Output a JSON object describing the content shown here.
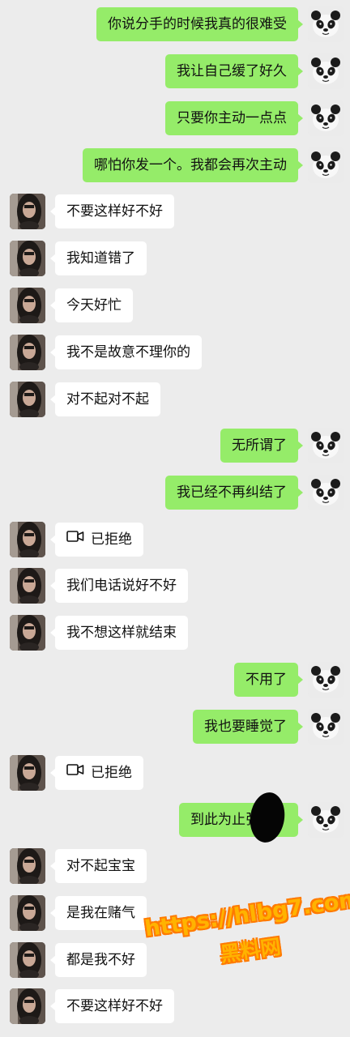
{
  "colors": {
    "background": "#ececec",
    "sent_bubble": "#95ec69",
    "received_bubble": "#ffffff",
    "watermark": "#ffb300"
  },
  "messages": [
    {
      "side": "out",
      "text": "你说分手的时候我真的很难受",
      "avatar": "panda"
    },
    {
      "side": "out",
      "text": "我让自己缓了好久",
      "avatar": "panda"
    },
    {
      "side": "out",
      "text": "只要你主动一点点",
      "avatar": "panda"
    },
    {
      "side": "out",
      "text": "哪怕你发一个。我都会再次主动",
      "avatar": "panda"
    },
    {
      "side": "in",
      "text": "不要这样好不好",
      "avatar": "girl"
    },
    {
      "side": "in",
      "text": "我知道错了",
      "avatar": "girl"
    },
    {
      "side": "in",
      "text": "今天好忙",
      "avatar": "girl"
    },
    {
      "side": "in",
      "text": "我不是故意不理你的",
      "avatar": "girl"
    },
    {
      "side": "in",
      "text": "对不起对不起",
      "avatar": "girl"
    },
    {
      "side": "out",
      "text": "无所谓了",
      "avatar": "panda"
    },
    {
      "side": "out",
      "text": "我已经不再纠结了",
      "avatar": "panda"
    },
    {
      "side": "in",
      "text": "已拒绝",
      "avatar": "girl",
      "icon": "video-call-icon"
    },
    {
      "side": "in",
      "text": "我们电话说好不好",
      "avatar": "girl"
    },
    {
      "side": "in",
      "text": "我不想这样就结束",
      "avatar": "girl"
    },
    {
      "side": "out",
      "text": "不用了",
      "avatar": "panda"
    },
    {
      "side": "out",
      "text": "我也要睡觉了",
      "avatar": "panda"
    },
    {
      "side": "in",
      "text": "已拒绝",
      "avatar": "girl",
      "icon": "video-call-icon"
    },
    {
      "side": "out",
      "text": "到此为止张",
      "avatar": "panda",
      "redacted": true
    },
    {
      "side": "in",
      "text": "对不起宝宝",
      "avatar": "girl"
    },
    {
      "side": "in",
      "text": "是我在赌气",
      "avatar": "girl"
    },
    {
      "side": "in",
      "text": "都是我不好",
      "avatar": "girl"
    },
    {
      "side": "in",
      "text": "不要这样好不好",
      "avatar": "girl"
    }
  ],
  "watermark": {
    "url": "https://hlbg7.com",
    "name": "黑料网"
  }
}
